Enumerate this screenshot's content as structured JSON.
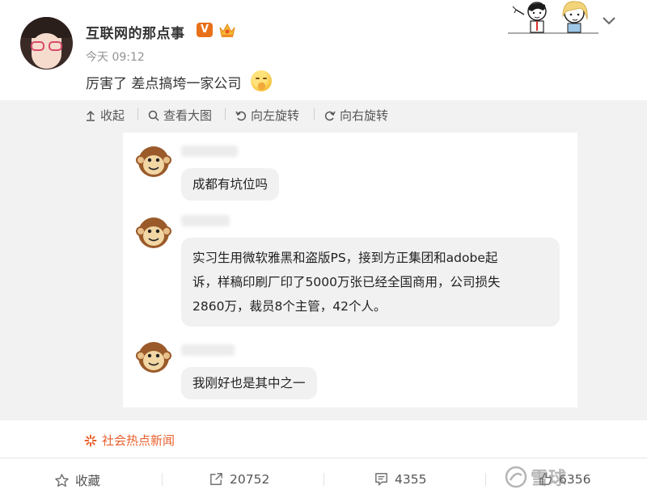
{
  "post": {
    "username": "互联网的那点事",
    "verified_badge": "V",
    "timestamp": "今天 09:12",
    "text": "厉害了 差点搞垮一家公司",
    "icons": {
      "avatar": "avatar",
      "verified": "verified-v-badge",
      "crown": "crown-icon",
      "emoji": "shush-emoji-icon",
      "menu": "chevron-down-icon"
    }
  },
  "image_toolbar": {
    "collapse": "收起",
    "view_large": "查看大图",
    "rotate_left": "向左旋转",
    "rotate_right": "向右旋转"
  },
  "chat": {
    "messages": [
      {
        "text": "成都有坑位吗"
      },
      {
        "lines": [
          "实习生用微软雅黑和盗版PS，接到方正集团和adobe起",
          "诉，样稿印刷厂印了5000万张已经全国商用，公司损失",
          "2860万，裁员8个主管，42个人。"
        ]
      },
      {
        "text": "我刚好也是其中之一"
      }
    ]
  },
  "topic": {
    "label": "社会热点新闻"
  },
  "actions": {
    "favorite": "收藏",
    "share_count": "20752",
    "comment_count": "4355",
    "like_count": "6356"
  },
  "watermark": {
    "text": "雪球"
  },
  "colors": {
    "accent_orange": "#e8602c",
    "vip_orange": "#e8701a",
    "panel_gray": "#f2f2f2",
    "bubble_gray": "#f1f1f1"
  }
}
